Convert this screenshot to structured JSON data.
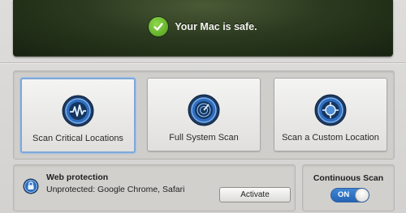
{
  "status": {
    "text": "Your Mac is safe."
  },
  "scan": {
    "buttons": [
      {
        "label": "Scan Critical Locations",
        "icon": "pulse-icon",
        "selected": true
      },
      {
        "label": "Full System Scan",
        "icon": "radar-icon",
        "selected": false
      },
      {
        "label": "Scan a Custom Location",
        "icon": "target-icon",
        "selected": false
      }
    ]
  },
  "web_protection": {
    "title": "Web protection",
    "status": "Unprotected: Google Chrome, Safari",
    "button": "Activate"
  },
  "continuous_scan": {
    "title": "Continuous Scan",
    "toggle": "ON"
  },
  "colors": {
    "accent_blue": "#2f6fc2",
    "safe_green": "#5fb226",
    "banner": "#2b3a1f"
  }
}
